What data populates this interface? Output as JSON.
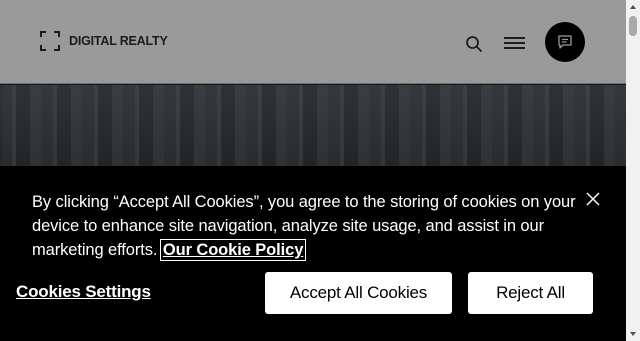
{
  "header": {
    "logo_text": "DIGITAL REALTY",
    "icons": {
      "search": "search-icon",
      "menu": "hamburger-menu-icon",
      "chat": "chat-icon"
    }
  },
  "cookie_banner": {
    "message": "By clicking “Accept All Cookies”, you agree to the storing of cookies on your device to enhance site navigation, analyze site usage, and assist in our marketing efforts.",
    "policy_link": "Our Cookie Policy",
    "settings_label": "Cookies Settings",
    "accept_label": "Accept All Cookies",
    "reject_label": "Reject All",
    "close_icon": "close-icon"
  },
  "colors": {
    "banner_bg": "#000000",
    "button_bg": "#ffffff",
    "header_bg_dimmed": "#9a9a9a"
  }
}
